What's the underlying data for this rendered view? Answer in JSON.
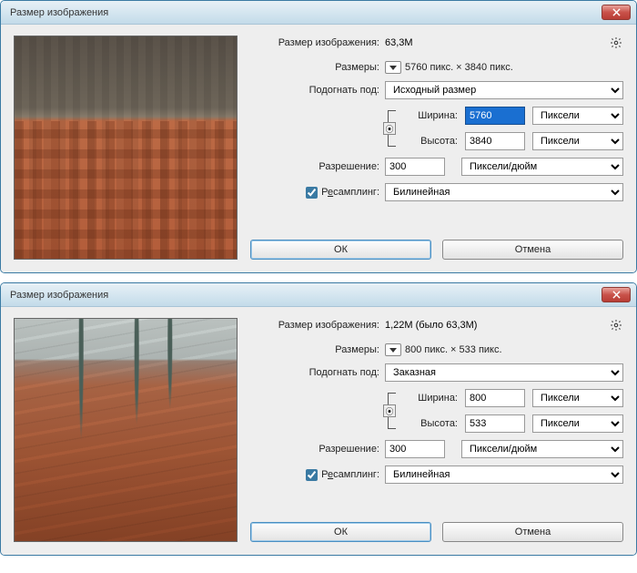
{
  "dialogs": [
    {
      "title": "Размер изображения",
      "info_label": "Размер изображения:",
      "info_value": "63,3M",
      "dims_label": "Размеры:",
      "dims_value": "5760 пикс.  ×  3840 пикс.",
      "fit_label": "Подогнать под:",
      "fit_value": "Исходный размер",
      "width_label": "Ширина:",
      "width_value": "5760",
      "width_selected": true,
      "width_unit": "Пиксели",
      "height_label": "Высота:",
      "height_value": "3840",
      "height_unit": "Пиксели",
      "res_label": "Разрешение:",
      "res_value": "300",
      "res_unit": "Пиксели/дюйм",
      "resample_label_pre": "Р",
      "resample_label_u": "е",
      "resample_label_post": "самплинг:",
      "resample_checked": true,
      "resample_method": "Билинейная",
      "ok": "ОК",
      "cancel": "Отмена"
    },
    {
      "title": "Размер изображения",
      "info_label": "Размер изображения:",
      "info_value": "1,22M (было 63,3M)",
      "dims_label": "Размеры:",
      "dims_value": "800 пикс.  ×  533 пикс.",
      "fit_label": "Подогнать под:",
      "fit_value": "Заказная",
      "width_label": "Ширина:",
      "width_value": "800",
      "width_selected": false,
      "width_unit": "Пиксели",
      "height_label": "Высота:",
      "height_value": "533",
      "height_unit": "Пиксели",
      "res_label": "Разрешение:",
      "res_value": "300",
      "res_unit": "Пиксели/дюйм",
      "resample_label_pre": "Р",
      "resample_label_u": "е",
      "resample_label_post": "самплинг:",
      "resample_checked": true,
      "resample_method": "Билинейная",
      "ok": "ОК",
      "cancel": "Отмена"
    }
  ]
}
